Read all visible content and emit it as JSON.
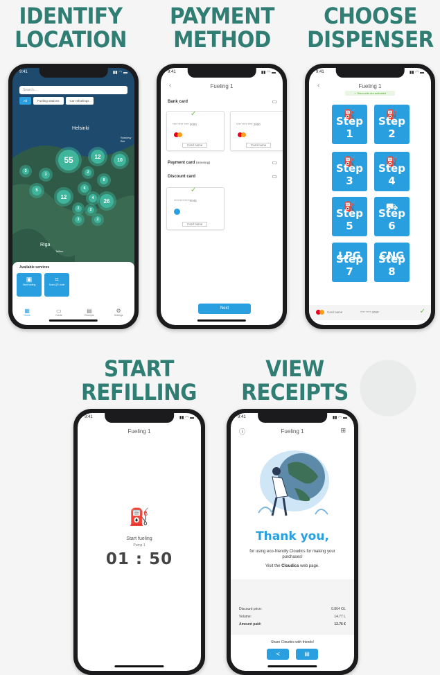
{
  "headings": {
    "identify": [
      "IDENTIFY",
      "LOCATION"
    ],
    "payment": [
      "PAYMENT",
      "METHOD"
    ],
    "dispenser": [
      "CHOOSE",
      "DISPENSER"
    ],
    "refilling": [
      "START",
      "REFILLING"
    ],
    "receipts": [
      "VIEW",
      "RECEIPTS"
    ]
  },
  "status_time": "9:41",
  "map": {
    "search_placeholder": "Search...",
    "chips": [
      "All",
      "Fueling stations",
      "Car refuelings"
    ],
    "city_labels": [
      "Helsinki",
      "Riga",
      "Sosnovy Bor",
      "Tallinn"
    ],
    "clusters": [
      "55",
      "12",
      "10",
      "3",
      "3",
      "2",
      "5",
      "8",
      "6",
      "12",
      "4",
      "26",
      "2",
      "2",
      "3",
      "2"
    ],
    "available_services_label": "Available services",
    "services": [
      "Start fueling",
      "Scan QR code"
    ],
    "nav": [
      "Home",
      "Cards",
      "Receipts",
      "Settings"
    ]
  },
  "payment": {
    "title": "Fueling 1",
    "bank_card_label": "Bank card",
    "card_numbers": [
      "**** **** **** 2000",
      "**** **** **** 2000"
    ],
    "card_action": [
      "Card name",
      "Card name"
    ],
    "payment_card_label": "Payment card",
    "payment_card_hint": "(missing)",
    "discount_card_label": "Discount card",
    "discount_number": "*************0045",
    "discount_action": "Card name",
    "next_label": "Next"
  },
  "dispenser": {
    "title": "Fueling 1",
    "subtitle": "Discounts are activated",
    "steps": [
      "Step 1",
      "Step 2",
      "Step 3",
      "Step 4",
      "Step 5",
      "Step 6",
      "Step 7",
      "Step 8"
    ],
    "step_tops": [
      "",
      "",
      "",
      "",
      "",
      "",
      "LPG",
      "CNG"
    ],
    "footer_card": "Card name",
    "footer_number": "**** **** 2000"
  },
  "refilling": {
    "title": "Fueling 1",
    "status": "Start fueling",
    "pump": "Pump 1",
    "timer": "01 : 50"
  },
  "receipt": {
    "title": "Fueling 1",
    "thanks": "Thank you,",
    "message": "for using eco-friendly Cloudics for making your purchases!",
    "visit_prefix": "Visit the",
    "visit_link": "Cloudics",
    "visit_suffix": "web page.",
    "rows": [
      {
        "label": "Discount price:",
        "value": "0.864 €/L"
      },
      {
        "label": "Volume:",
        "value": "14.77 L"
      },
      {
        "label": "Amount paid:",
        "value": "12.76 €"
      }
    ],
    "share_label": "Share Cloudics with friends!"
  },
  "colors": {
    "heading": "#2f7d73",
    "accent": "#2a9fdf",
    "map_cluster": "#3fb59c",
    "map_water": "#1e4b6d"
  }
}
